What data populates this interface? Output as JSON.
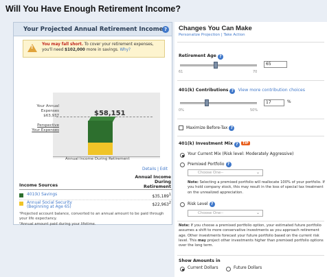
{
  "page": {
    "title": "Will You Have Enough Retirement Income?"
  },
  "left_panel": {
    "title": "Your Projected Annual Retirement Income",
    "warning": {
      "bold_text": "You may fall short.",
      "line1_rest": "To cover your retirement expenses,",
      "line2_pre": "you'll need",
      "amount": "$102,000",
      "line2_post": "more in savings.",
      "link": "Why?"
    },
    "chart": {
      "goal_label_1": "Your Annual",
      "goal_label_2": "Expenses",
      "goal_value": "$63,937",
      "perspective_1": "Perspective",
      "perspective_2": "Your Expenses",
      "bar_value": "$58,151",
      "xlabel": "Annual Income During Retirement"
    },
    "chart_data": {
      "type": "bar",
      "categories": [
        "Annual Income During Retirement"
      ],
      "series": [
        {
          "name": "401(k) Savings",
          "values": [
            35189
          ],
          "color": "#2d6f2e"
        },
        {
          "name": "Annual Social Security",
          "values": [
            22963
          ],
          "color": "#f0c428"
        }
      ],
      "total_label": "$58,151",
      "reference_line": {
        "label": "Your Annual Expenses",
        "value": 63937
      }
    },
    "links": {
      "details": "Details",
      "edit": "Edit"
    },
    "table": {
      "col1": "Income Sources",
      "col2_line1": "Annual Income",
      "col2_line2": "During",
      "col2_line3": "Retirement",
      "rows": [
        {
          "label": "401(k) Savings",
          "label2": "",
          "value": "$35,189",
          "sup": "1",
          "color": "#2d6f2e"
        },
        {
          "label": "Annual Social Security",
          "label2": "(Beginning at Age 65)",
          "value": "$22,963",
          "sup": "2",
          "color": "#f0c428"
        }
      ]
    },
    "footnotes": [
      "¹Projected account balance, converted to an annual amount to be paid through your life expectancy.",
      "²Annual amount paid during your lifetime."
    ]
  },
  "right_panel": {
    "title": "Changes You Can Make",
    "sub_links": "Personalize Projection | Take Action",
    "retirement_age": {
      "label": "Retirement Age",
      "value": "65",
      "min": "61",
      "max": "70",
      "fraction": 0.444
    },
    "contributions": {
      "label": "401(k) Contributions",
      "link": "View more contribution choices",
      "value": "17",
      "unit": "%",
      "min": "0%",
      "max": "50%",
      "fraction": 0.34
    },
    "maximize": {
      "label": "Maximize Before-Tax"
    },
    "investment_mix": {
      "label": "401(k) Investment Mix",
      "tip": "TIP",
      "option_current": "Your Current Mix (Risk level: Moderately Aggressive)",
      "option_premixed": "Premixed Portfolio",
      "premixed_placeholder": "Choose One--",
      "premixed_note_bold": "Note:",
      "premixed_note": "Selecting a premixed portfolio will reallocate 100% of your portfolio. If you hold company stock, this may result in the loss of special tax treatment on the unrealized appreciation.",
      "option_risk": "Risk Level",
      "risk_placeholder": "Choose One--"
    },
    "note2": {
      "bold1": "Note:",
      "text1": "If you choose a premixed portfolio option, your estimated future portfolio assumes a shift to more conservative investments as you approach retirement age. Other investments forecast your future portfolio based on the current risk level. This",
      "bold2": "may",
      "text2": "project other investments higher than premixed portfolio options over the long term."
    },
    "show_amounts": {
      "label": "Show Amounts in",
      "option1": "Current Dollars",
      "option2": "Future Dollars"
    }
  }
}
